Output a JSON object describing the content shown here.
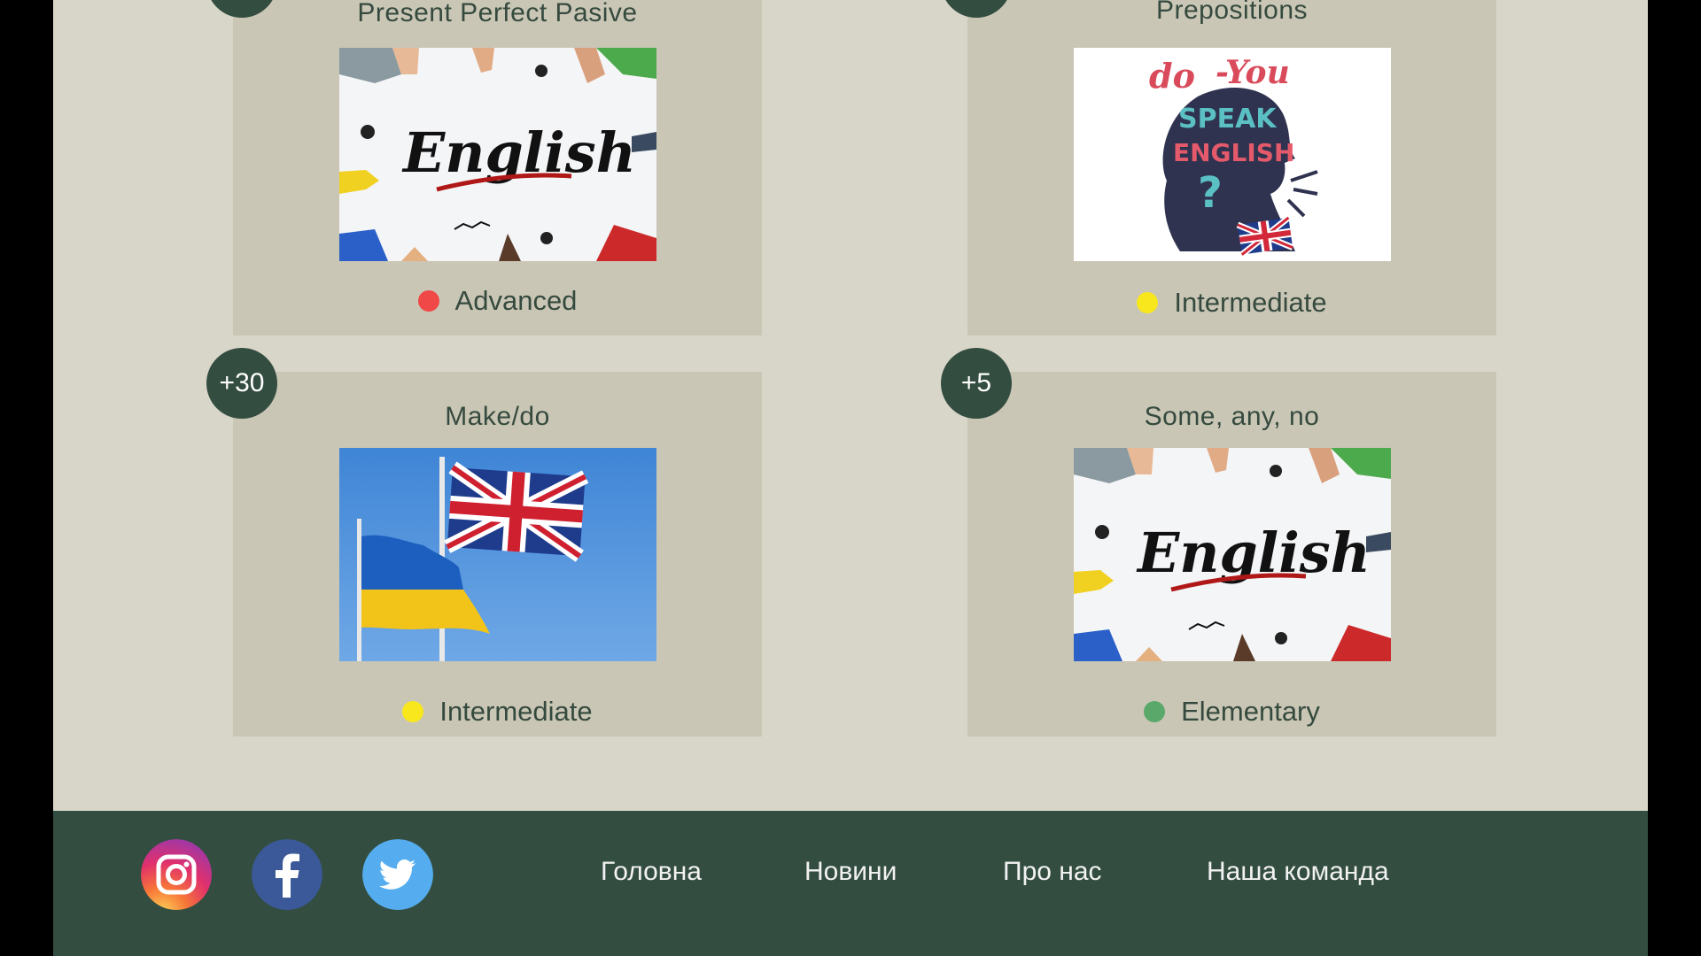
{
  "cards": [
    {
      "title": "Present Perfect Pasive",
      "image": "english-hands-photo",
      "level": "Advanced",
      "level_color": "#f04747",
      "badge": ""
    },
    {
      "title": "Prepositions",
      "image": "do-you-speak-english-illustration",
      "level": "Intermediate",
      "level_color": "#f8e71c",
      "badge": ""
    },
    {
      "title": "Make/do",
      "image": "ukraine-uk-flags-photo",
      "level": "Intermediate",
      "level_color": "#f8e71c",
      "badge": "+30"
    },
    {
      "title": "Some, any, no",
      "image": "english-hands-photo",
      "level": "Elementary",
      "level_color": "#5aa86a",
      "badge": "+5"
    }
  ],
  "footer": {
    "social": [
      "instagram-icon",
      "facebook-icon",
      "twitter-icon"
    ],
    "nav": [
      "Головна",
      "Новини",
      "Про нас",
      "Наша команда"
    ]
  },
  "colors": {
    "page_bg": "#d8d6c9",
    "card_bg": "#cac6b5",
    "accent_dark_green": "#334d40",
    "text": "#354a3e"
  }
}
